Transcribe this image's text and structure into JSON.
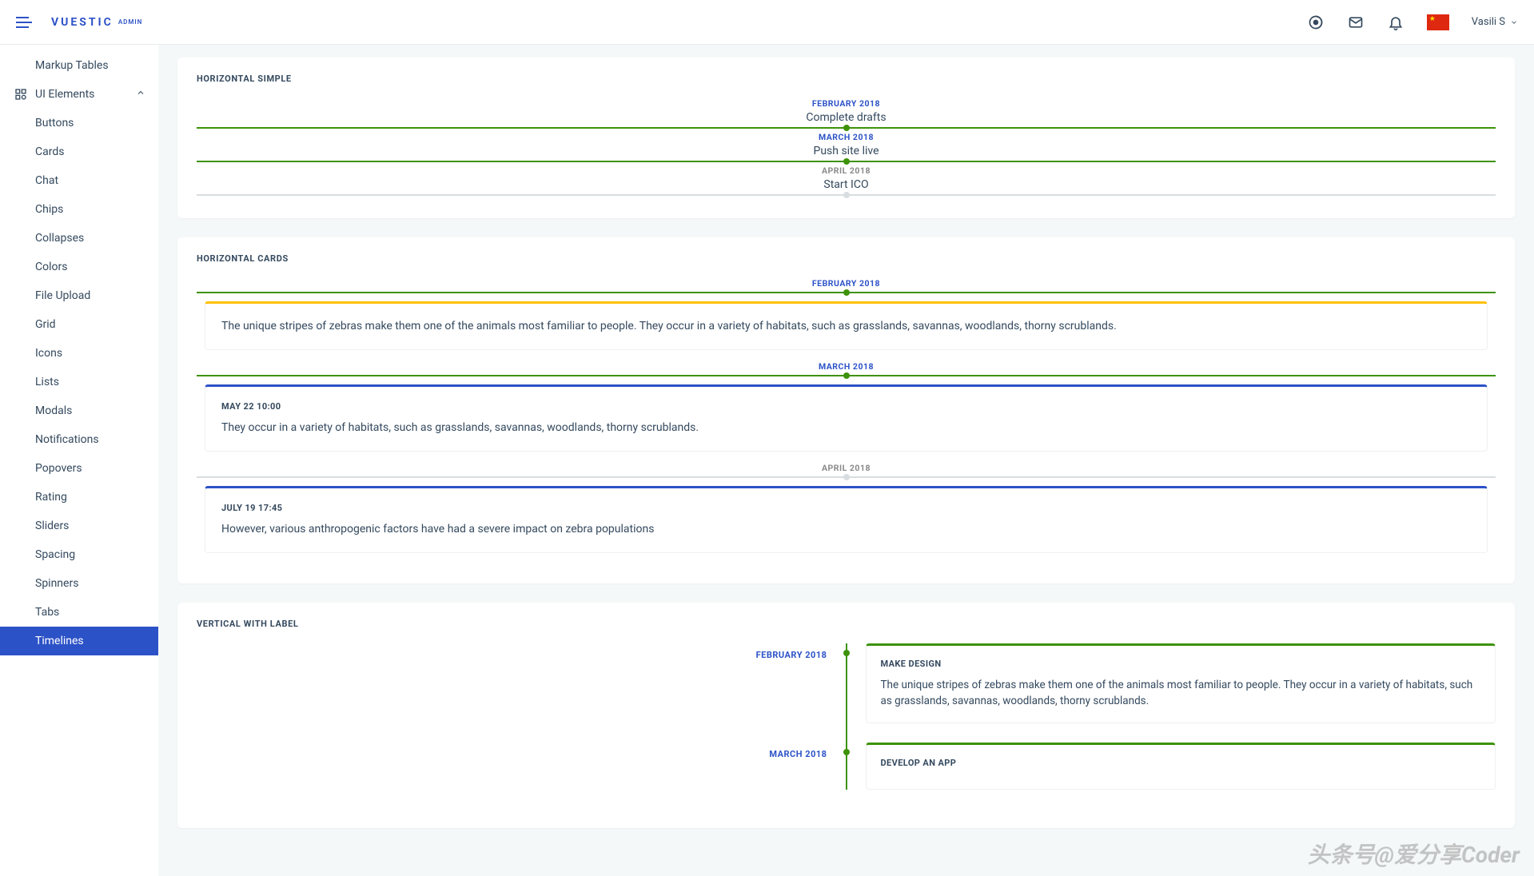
{
  "header": {
    "logo_main": "VUESTIC",
    "logo_sub": "ADMIN",
    "user_name": "Vasili S"
  },
  "sidebar": {
    "markup_tables": "Markup Tables",
    "ui_elements": "UI Elements",
    "items": [
      "Buttons",
      "Cards",
      "Chat",
      "Chips",
      "Collapses",
      "Colors",
      "File Upload",
      "Grid",
      "Icons",
      "Lists",
      "Modals",
      "Notifications",
      "Popovers",
      "Rating",
      "Sliders",
      "Spacing",
      "Spinners",
      "Tabs",
      "Timelines"
    ]
  },
  "sections": {
    "hsimple": {
      "title": "HORIZONTAL SIMPLE",
      "items": [
        {
          "date": "FEBRUARY 2018",
          "text": "Complete drafts",
          "active": true
        },
        {
          "date": "MARCH 2018",
          "text": "Push site live",
          "active": true
        },
        {
          "date": "APRIL 2018",
          "text": "Start ICO",
          "active": false
        }
      ]
    },
    "hcards": {
      "title": "HORIZONTAL CARDS",
      "items": [
        {
          "date": "FEBRUARY 2018",
          "active": true,
          "color": "yellow",
          "sub": "",
          "body": "The unique stripes of zebras make them one of the animals most familiar to people. They occur in a variety of habitats, such as grasslands, savannas, woodlands, thorny scrublands."
        },
        {
          "date": "MARCH 2018",
          "active": true,
          "color": "blue",
          "sub": "MAY 22 10:00",
          "body": "They occur in a variety of habitats, such as grasslands, savannas, woodlands, thorny scrublands."
        },
        {
          "date": "APRIL 2018",
          "active": false,
          "color": "blue",
          "sub": "JULY 19 17:45",
          "body": "However, various anthropogenic factors have had a severe impact on zebra populations"
        }
      ]
    },
    "vlabel": {
      "title": "VERTICAL WITH LABEL",
      "items": [
        {
          "date": "FEBRUARY 2018",
          "card_title": "MAKE DESIGN",
          "body": "The unique stripes of zebras make them one of the animals most familiar to people. They occur in a variety of habitats, such as grasslands, savannas, woodlands, thorny scrublands."
        },
        {
          "date": "MARCH 2018",
          "card_title": "DEVELOP AN APP",
          "body": ""
        }
      ]
    }
  },
  "watermark": "头条号@爱分享Coder"
}
